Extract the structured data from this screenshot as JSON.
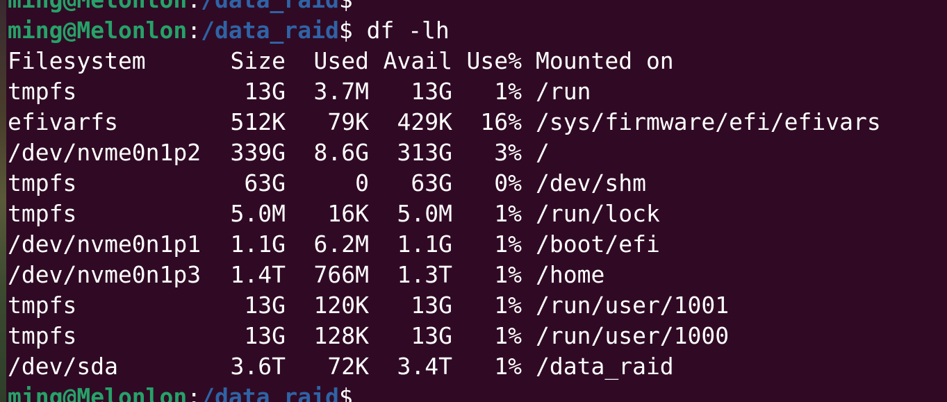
{
  "prompt_user": "ming@Melonlon",
  "prompt_colon": ":",
  "prompt_path": "/data_raid",
  "prompt_symbol": "$",
  "command": " df -lh",
  "header": {
    "filesystem": "Filesystem",
    "size": "Size",
    "used": "Used",
    "avail": "Avail",
    "use_pct": "Use%",
    "mounted": "Mounted on"
  },
  "rows": [
    {
      "filesystem": "tmpfs",
      "size": "13G",
      "used": "3.7M",
      "avail": "13G",
      "use_pct": "1%",
      "mounted": "/run"
    },
    {
      "filesystem": "efivarfs",
      "size": "512K",
      "used": "79K",
      "avail": "429K",
      "use_pct": "16%",
      "mounted": "/sys/firmware/efi/efivars"
    },
    {
      "filesystem": "/dev/nvme0n1p2",
      "size": "339G",
      "used": "8.6G",
      "avail": "313G",
      "use_pct": "3%",
      "mounted": "/"
    },
    {
      "filesystem": "tmpfs",
      "size": "63G",
      "used": "0",
      "avail": "63G",
      "use_pct": "0%",
      "mounted": "/dev/shm"
    },
    {
      "filesystem": "tmpfs",
      "size": "5.0M",
      "used": "16K",
      "avail": "5.0M",
      "use_pct": "1%",
      "mounted": "/run/lock"
    },
    {
      "filesystem": "/dev/nvme0n1p1",
      "size": "1.1G",
      "used": "6.2M",
      "avail": "1.1G",
      "use_pct": "1%",
      "mounted": "/boot/efi"
    },
    {
      "filesystem": "/dev/nvme0n1p3",
      "size": "1.4T",
      "used": "766M",
      "avail": "1.3T",
      "use_pct": "1%",
      "mounted": "/home"
    },
    {
      "filesystem": "tmpfs",
      "size": "13G",
      "used": "120K",
      "avail": "13G",
      "use_pct": "1%",
      "mounted": "/run/user/1001"
    },
    {
      "filesystem": "tmpfs",
      "size": "13G",
      "used": "128K",
      "avail": "13G",
      "use_pct": "1%",
      "mounted": "/run/user/1000"
    },
    {
      "filesystem": "/dev/sda",
      "size": "3.6T",
      "used": "72K",
      "avail": "3.4T",
      "use_pct": "1%",
      "mounted": "/data_raid"
    }
  ],
  "colors": {
    "background": "#300a24",
    "prompt_user": "#26a269",
    "prompt_path": "#2f63a6",
    "text": "#ffffff"
  }
}
